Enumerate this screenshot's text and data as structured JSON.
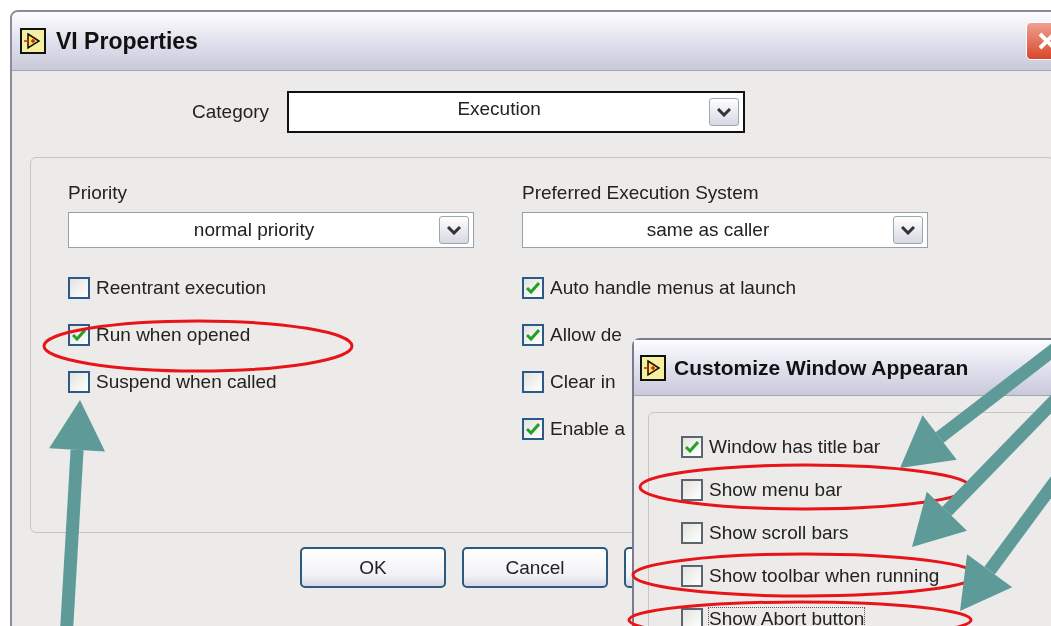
{
  "window": {
    "title": "VI Properties"
  },
  "category": {
    "label": "Category",
    "value": "Execution"
  },
  "left": {
    "label": "Priority",
    "value": "normal priority",
    "options": [
      {
        "label": "Reentrant execution",
        "checked": false
      },
      {
        "label": "Run when opened",
        "checked": true
      },
      {
        "label": "Suspend when called",
        "checked": false
      }
    ]
  },
  "right": {
    "label": "Preferred Execution System",
    "value": "same as caller",
    "options": [
      {
        "label": "Auto handle menus at launch",
        "checked": true
      },
      {
        "label": "Allow de",
        "checked": true
      },
      {
        "label": "Clear in",
        "checked": false
      },
      {
        "label": "Enable a",
        "checked": true
      }
    ]
  },
  "buttons": [
    "OK",
    "Cancel"
  ],
  "dialog": {
    "title": "Customize Window Appearan",
    "options": [
      {
        "label": "Window has title bar",
        "checked": true
      },
      {
        "label": "Show menu bar",
        "checked": false
      },
      {
        "label": "Show scroll bars",
        "checked": false
      },
      {
        "label": "Show toolbar when running",
        "checked": false
      },
      {
        "label": "Show Abort button",
        "checked": false
      }
    ]
  }
}
